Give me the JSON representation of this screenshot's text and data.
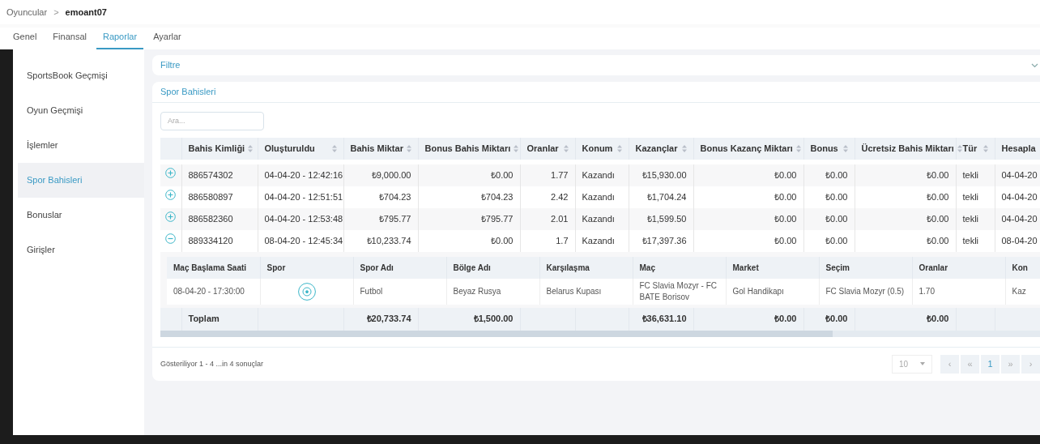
{
  "breadcrumb": {
    "parent": "Oyuncular",
    "separator": ">",
    "current": "emoant07"
  },
  "tabs": [
    {
      "label": "Genel",
      "selected": false
    },
    {
      "label": "Finansal",
      "selected": false
    },
    {
      "label": "Raporlar",
      "selected": true
    },
    {
      "label": "Ayarlar",
      "selected": false
    }
  ],
  "sidebar": {
    "items": [
      {
        "label": "SportsBook Geçmişi",
        "selected": false
      },
      {
        "label": "Oyun Geçmişi",
        "selected": false
      },
      {
        "label": "İşlemler",
        "selected": false
      },
      {
        "label": "Spor Bahisleri",
        "selected": true
      },
      {
        "label": "Bonuslar",
        "selected": false
      },
      {
        "label": "Girişler",
        "selected": false
      }
    ]
  },
  "filter": {
    "title": "Filtre"
  },
  "bets": {
    "title": "Spor Bahisleri",
    "search": {
      "placeholder": "Ara..."
    },
    "columns": [
      "Bahis Kimliği",
      "Oluşturuldu",
      "Bahis Miktar",
      "Bonus Bahis Miktarı",
      "Oranlar",
      "Konum",
      "Kazançlar",
      "Bonus Kazanç Miktarı",
      "Bonus",
      "Ücretsiz Bahis Miktarı",
      "Tür",
      "Hesapla"
    ],
    "rows": [
      {
        "expanded": false,
        "cells": [
          "886574302",
          "04-04-20 - 12:42:16",
          "₺9,000.00",
          "₺0.00",
          "1.77",
          "Kazandı",
          "₺15,930.00",
          "₺0.00",
          "₺0.00",
          "₺0.00",
          "tekli",
          "04-04-20"
        ]
      },
      {
        "expanded": false,
        "cells": [
          "886580897",
          "04-04-20 - 12:51:51",
          "₺704.23",
          "₺704.23",
          "2.42",
          "Kazandı",
          "₺1,704.24",
          "₺0.00",
          "₺0.00",
          "₺0.00",
          "tekli",
          "04-04-20"
        ]
      },
      {
        "expanded": false,
        "cells": [
          "886582360",
          "04-04-20 - 12:53:48",
          "₺795.77",
          "₺795.77",
          "2.01",
          "Kazandı",
          "₺1,599.50",
          "₺0.00",
          "₺0.00",
          "₺0.00",
          "tekli",
          "04-04-20"
        ]
      },
      {
        "expanded": true,
        "cells": [
          "889334120",
          "08-04-20 - 12:45:34",
          "₺10,233.74",
          "₺0.00",
          "1.7",
          "Kazandı",
          "₺17,397.36",
          "₺0.00",
          "₺0.00",
          "₺0.00",
          "tekli",
          "08-04-20"
        ],
        "details": {
          "columns": [
            "Maç Başlama Saati",
            "Spor",
            "Spor Adı",
            "Bölge Adı",
            "Karşılaşma",
            "Maç",
            "Market",
            "Seçim",
            "Oranlar",
            "Kon"
          ],
          "rows": [
            {
              "cells": [
                "08-04-20 - 17:30:00",
                null,
                "Futbol",
                "Beyaz Rusya",
                "Belarus Kupası",
                "FC Slavia Mozyr - FC BATE Borisov",
                "Gol Handikapı",
                "FC Slavia Mozyr (0.5)",
                "1.70",
                "Kaz"
              ]
            }
          ]
        }
      }
    ],
    "totals": {
      "label": "Toplam",
      "cells": [
        null,
        "₺20,733.74",
        "₺1,500.00",
        null,
        null,
        "₺36,631.10",
        "₺0.00",
        "₺0.00",
        "₺0.00",
        null,
        null
      ]
    },
    "footer": {
      "summary": "Gösteriliyor 1 - 4 ...in 4 sonuçlar",
      "page_size": "10",
      "pager": [
        {
          "label": "‹",
          "selected": false
        },
        {
          "label": "«",
          "selected": false
        },
        {
          "label": "1",
          "selected": true
        },
        {
          "label": "»",
          "selected": false
        },
        {
          "label": "›",
          "selected": false
        }
      ]
    }
  }
}
